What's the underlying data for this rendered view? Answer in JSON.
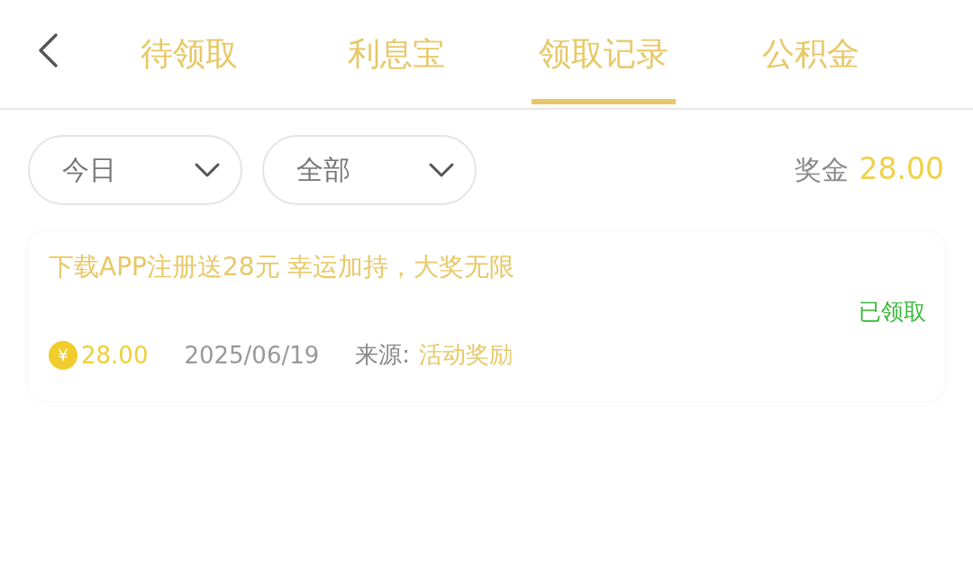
{
  "tabs": [
    {
      "label": "待领取",
      "selected": false
    },
    {
      "label": "利息宝",
      "selected": false
    },
    {
      "label": "领取记录",
      "selected": true
    },
    {
      "label": "公积金",
      "selected": false
    }
  ],
  "filters": [
    {
      "label": "今日"
    },
    {
      "label": "全部"
    }
  ],
  "bonus": {
    "label": "奖金",
    "amount": "28.00"
  },
  "records": [
    {
      "title": "下载APP注册送28元 幸运加持，大奖无限",
      "status": "已领取",
      "coin_symbol": "¥",
      "amount": "28.00",
      "date": "2025/06/19",
      "source_label": "来源:",
      "source": "活动奖励"
    }
  ]
}
